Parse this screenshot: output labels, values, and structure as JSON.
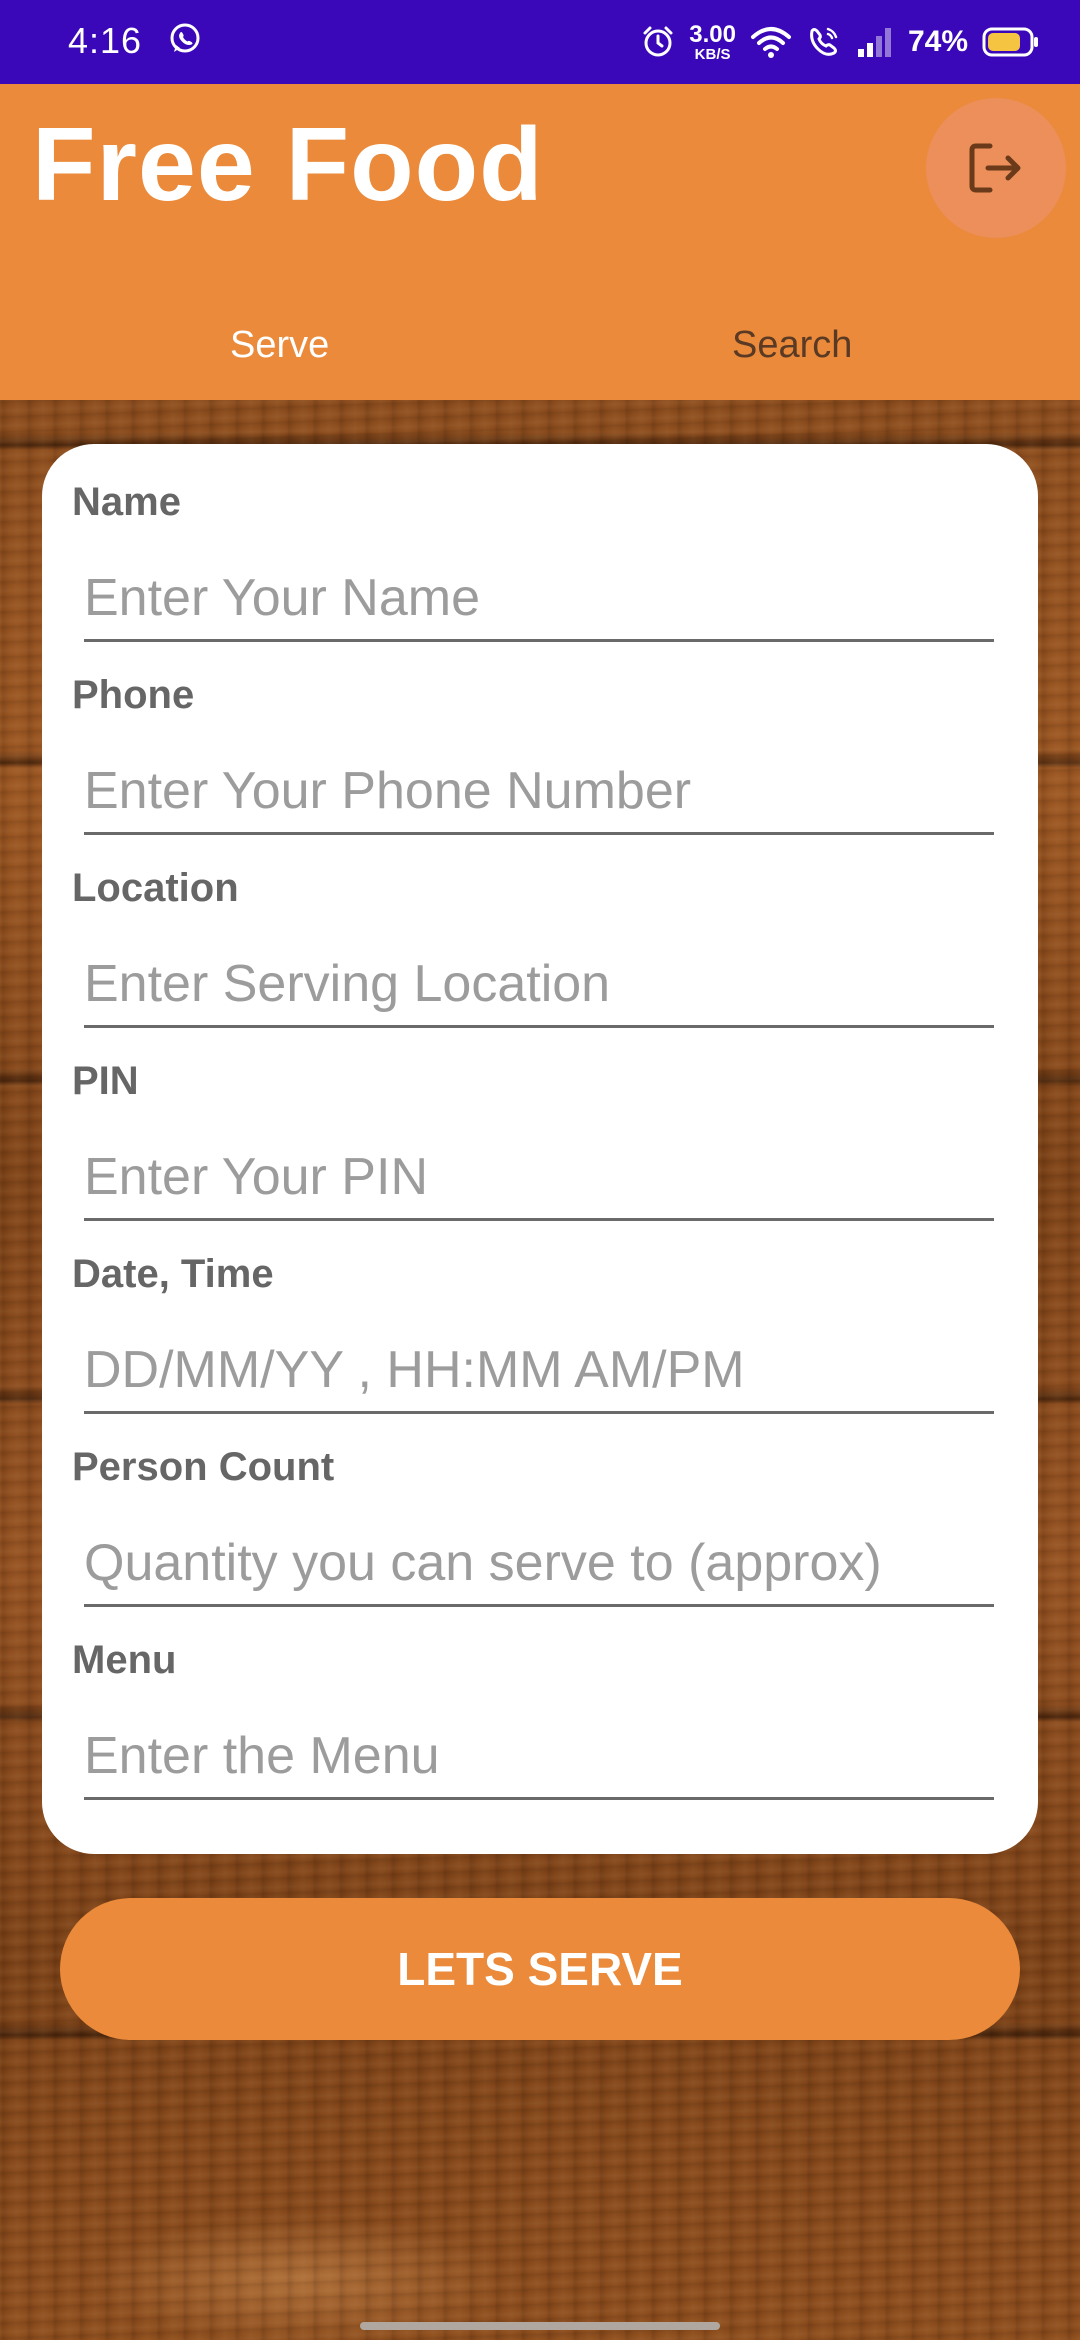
{
  "status_bar": {
    "time": "4:16",
    "network_speed_value": "3.00",
    "network_speed_unit": "KB/S",
    "battery_percent": "74%",
    "icons": [
      "whatsapp-icon",
      "alarm-icon",
      "wifi-icon",
      "wifi-calling-icon",
      "signal-icon",
      "battery-icon"
    ]
  },
  "app_bar": {
    "title": "Free Food",
    "logout_icon": "logout-icon",
    "tabs": [
      {
        "label": "Serve",
        "selected": true
      },
      {
        "label": "Search",
        "selected": false
      }
    ]
  },
  "form": {
    "fields": [
      {
        "label": "Name",
        "placeholder": "Enter Your Name",
        "value": ""
      },
      {
        "label": "Phone",
        "placeholder": "Enter Your Phone Number",
        "value": ""
      },
      {
        "label": "Location",
        "placeholder": "Enter Serving Location",
        "value": ""
      },
      {
        "label": "PIN",
        "placeholder": "Enter Your PIN",
        "value": ""
      },
      {
        "label": "Date, Time",
        "placeholder": "DD/MM/YY , HH:MM AM/PM",
        "value": ""
      },
      {
        "label": "Person Count",
        "placeholder": "Quantity you can serve to (approx)",
        "value": ""
      },
      {
        "label": "Menu",
        "placeholder": "Enter the Menu",
        "value": ""
      }
    ]
  },
  "submit_button": {
    "label": "LETS SERVE"
  },
  "colors": {
    "status_bar": "#3a08b8",
    "primary": "#ea8a3a",
    "card": "#ffffff",
    "label_text": "#666666",
    "placeholder_text": "#9c9c9c"
  }
}
